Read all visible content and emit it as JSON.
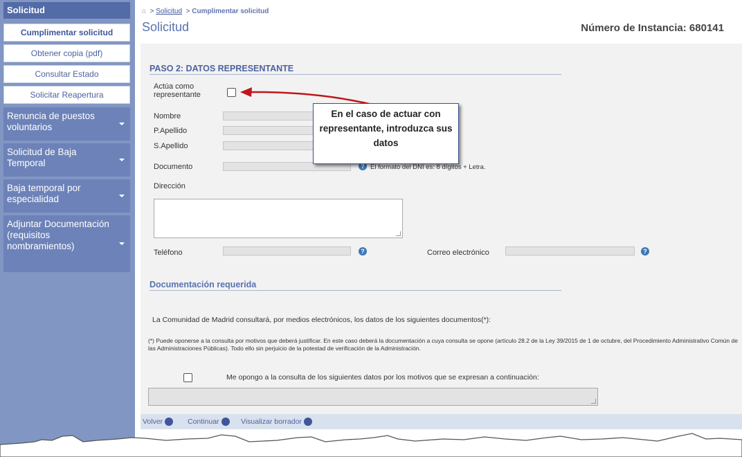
{
  "sidebar": {
    "header": "Solicitud",
    "sub_items": [
      "Cumplimentar solicitud",
      "Obtener copia (pdf)",
      "Consultar Estado",
      "Solicitar Reapertura"
    ],
    "groups": [
      "Renuncia de puestos voluntarios",
      "Solicitud de Baja Temporal",
      "Baja temporal por especialidad",
      "Adjuntar Documentación (requisitos nombramientos)"
    ]
  },
  "breadcrumb": {
    "sep": ">",
    "link": "Solicitud",
    "current": "Cumplimentar solicitud"
  },
  "page_title": "Solicitud",
  "instance_label": "Número de Instancia: 680141",
  "step_title": "PASO 2: DATOS REPRESENTANTE",
  "form": {
    "acts_as_label": "Actúa como representante",
    "nombre": "Nombre",
    "p_apellido": "P.Apellido",
    "s_apellido": "S.Apellido",
    "documento": "Documento",
    "dni_hint": "El formato del DNI es: 8 dígitos + Letra.",
    "direccion": "Dirección",
    "telefono": "Teléfono",
    "correo": "Correo electrónico"
  },
  "doc_section": {
    "title": "Documentación requerida",
    "consult_text": "La Comunidad de Madrid consultará, por medios electrónicos, los datos de los siguientes documentos(*):",
    "note": "(*) Puede oponerse a la consulta por motivos que deberá justificar. En este caso deberá la documentación a cuya consulta se opone (artículo 28.2 de la Ley 39/2015 de 1 de octubre, del Procedimiento Administrativo Común de las Administraciones Públicas). Todo ello sin perjuicio de la potestad de verificación de la Administración.",
    "oppose_label": "Me opongo a la consulta de los siguientes datos por los motivos que se expresan a continuación:"
  },
  "footer": {
    "back": "Volver",
    "continue": "Continuar",
    "draft": "Visualizar borrador"
  },
  "callout": "En el caso de actuar con representante, introduzca sus datos",
  "colors": {
    "sidebar": "#8196c3",
    "accent": "#3f579a",
    "arrow": "#c0161b"
  }
}
